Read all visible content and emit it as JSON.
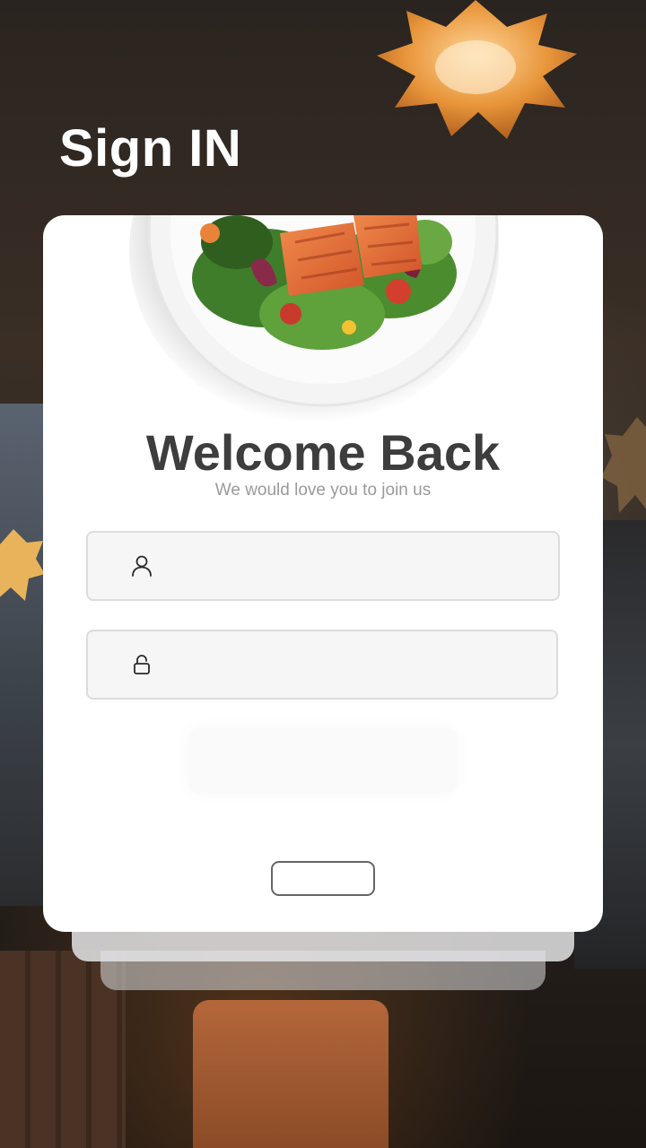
{
  "header": {
    "title": "Sign IN"
  },
  "card": {
    "heading": "Welcome Back",
    "subtitle": "We would love you to join us"
  },
  "form": {
    "username": {
      "value": "",
      "icon": "user-icon"
    },
    "password": {
      "value": "",
      "icon": "lock-icon"
    },
    "primary_button_label": "",
    "secondary_button_label": ""
  },
  "colors": {
    "title": "#ffffff",
    "heading": "#3d3d3d",
    "subtitle": "#9a9a9a",
    "field_bg": "#f6f6f6",
    "field_border": "#dcdcdc"
  }
}
